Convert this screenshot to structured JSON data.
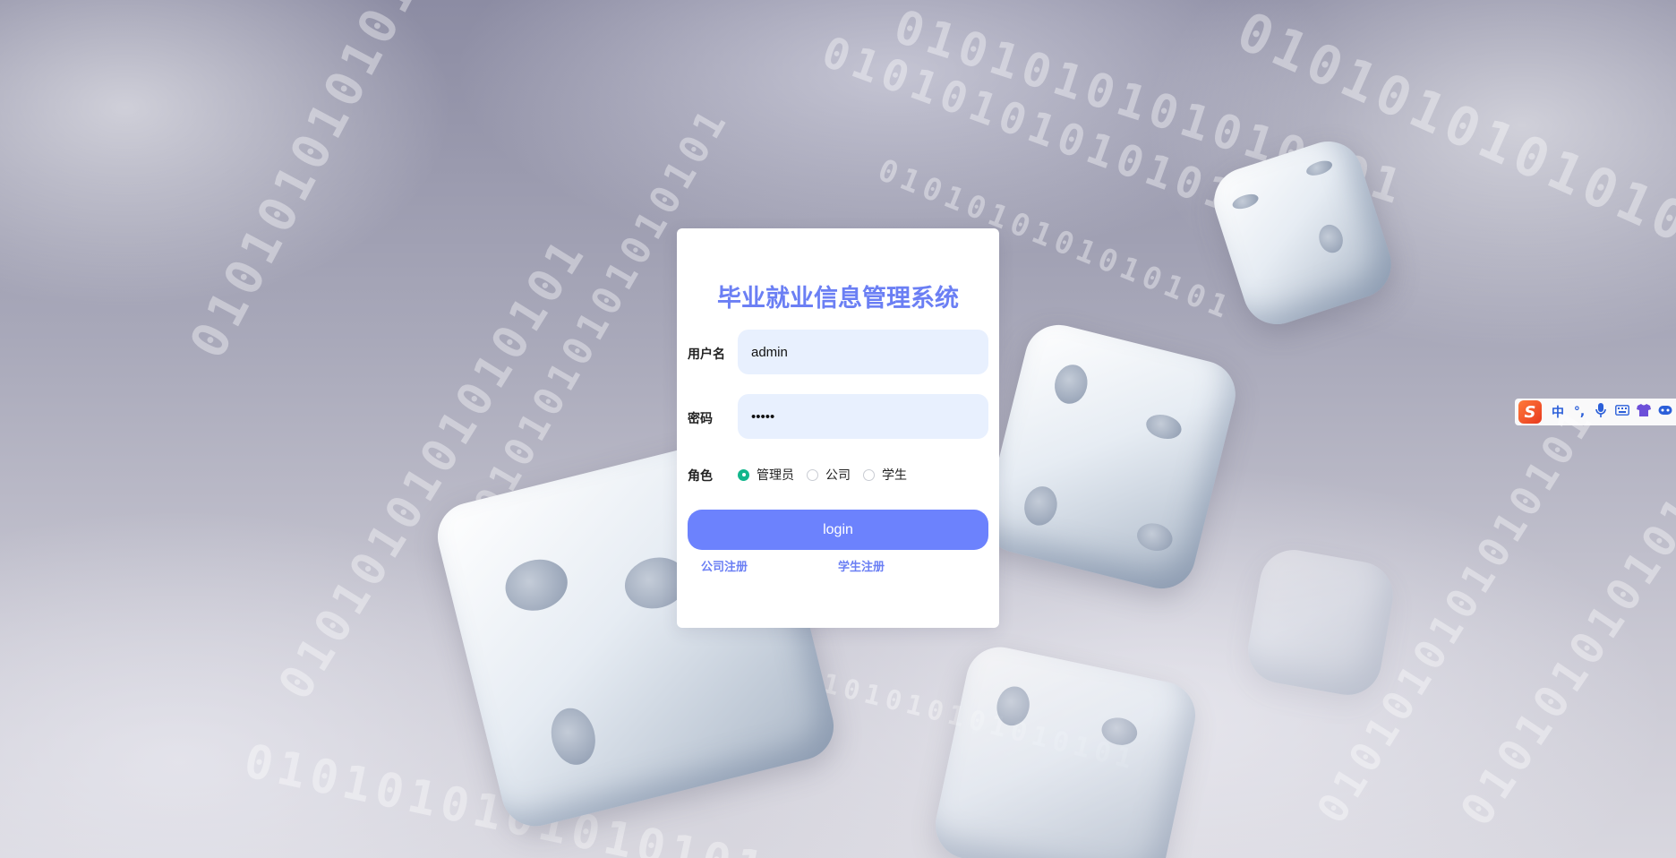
{
  "app": {
    "title": "毕业就业信息管理系统"
  },
  "form": {
    "username_label": "用户名",
    "username_value": "admin",
    "password_label": "密码",
    "password_value": "12345",
    "role_label": "角色",
    "roles": [
      {
        "label": "管理员",
        "checked": true
      },
      {
        "label": "公司",
        "checked": false
      },
      {
        "label": "学生",
        "checked": false
      }
    ],
    "login_label": "login",
    "company_register": "公司注册",
    "student_register": "学生注册"
  },
  "ime": {
    "logo": "S",
    "mode": "中",
    "punct": "°,",
    "icons": [
      "microphone-icon",
      "keyboard-icon",
      "shirt-icon",
      "gamepad-icon"
    ]
  },
  "background": {
    "binary_text": "0101010101010101",
    "accent_color": "#6c82fd",
    "title_color": "#6b7ff4",
    "radio_checked_color": "#13b68c"
  }
}
